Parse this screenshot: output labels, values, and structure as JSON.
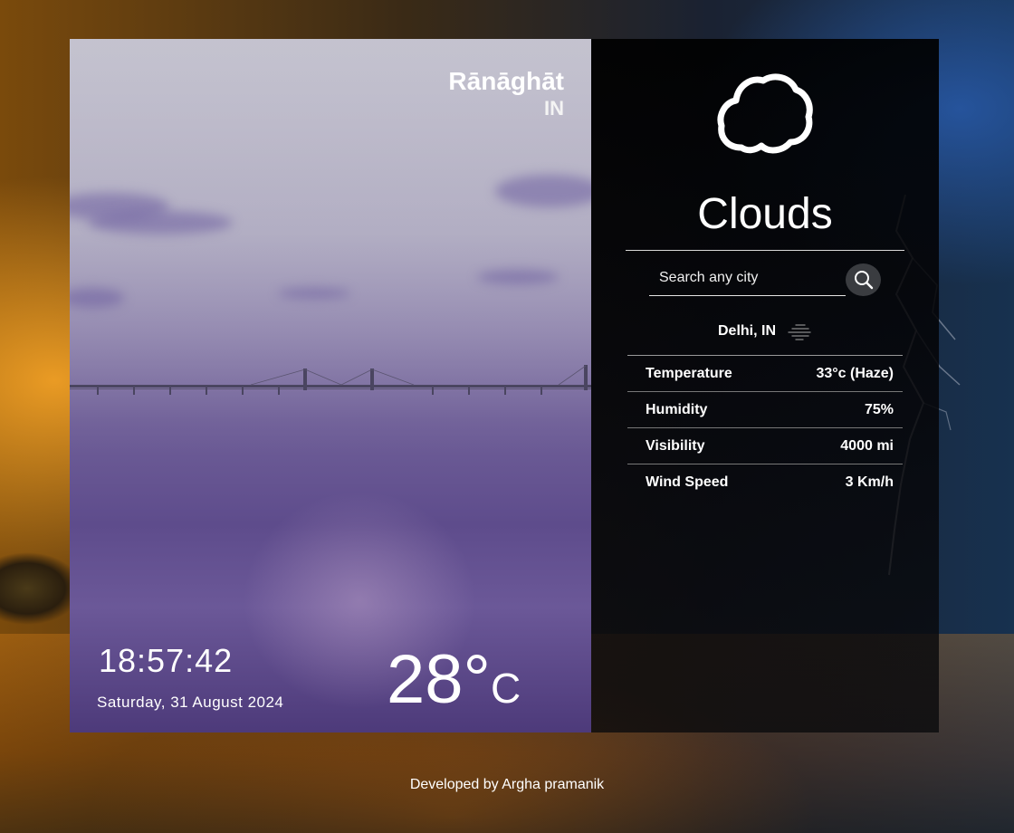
{
  "location": {
    "city": "Rānāghāt",
    "country": "IN"
  },
  "time": {
    "clock": "18:57:42",
    "date": "Saturday, 31 August 2024"
  },
  "current": {
    "temp": "28°",
    "unit": "C"
  },
  "condition": {
    "label": "Clouds",
    "icon": "cloud-icon"
  },
  "search": {
    "placeholder": "Search any city",
    "value": "",
    "button_icon": "search-icon"
  },
  "result": {
    "place": "Delhi, IN",
    "icon": "haze-icon",
    "rows": [
      {
        "label": "Temperature",
        "value": "33°c (Haze)"
      },
      {
        "label": "Humidity",
        "value": "75%"
      },
      {
        "label": "Visibility",
        "value": "4000 mi"
      },
      {
        "label": "Wind Speed",
        "value": "3 Km/h"
      }
    ]
  },
  "footer": {
    "text": "Developed by Argha pramanik"
  },
  "colors": {
    "panel_dark": "#000000",
    "text": "#ffffff",
    "search_button": "#3a3c40"
  }
}
